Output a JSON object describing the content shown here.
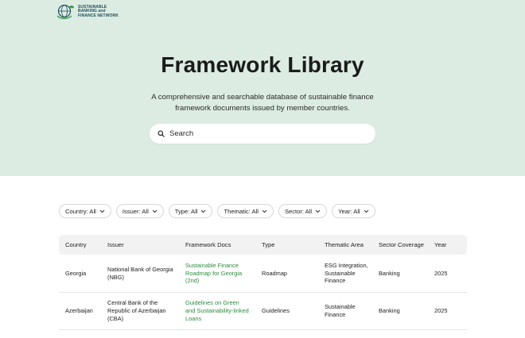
{
  "logo": {
    "line1": "SUSTAINABLE",
    "line2": "BANKING and",
    "line3": "FINANCE NETWORK",
    "icon": "globe-leaf-icon"
  },
  "hero": {
    "title": "Framework Library",
    "subtitle": "A comprehensive and searchable database of sustainable finance framework documents issued by member countries."
  },
  "search": {
    "placeholder": "Search",
    "value": ""
  },
  "filters": [
    {
      "label": "Country: All"
    },
    {
      "label": "Issuer: All"
    },
    {
      "label": "Type: All"
    },
    {
      "label": "Thematic: All"
    },
    {
      "label": "Sector: All"
    },
    {
      "label": "Year: All"
    }
  ],
  "table": {
    "headers": [
      "Country",
      "Issuer",
      "Framework Docs",
      "Type",
      "Thematic Area",
      "Sector Coverage",
      "Year"
    ],
    "rows": [
      {
        "country": "Georgia",
        "issuer": "National Bank of Georgia (NBG)",
        "doc": "Sustainable Finance Roadmap for Georgia (2nd)",
        "type": "Roadmap",
        "thematic": "ESG Integration, Sustainable Finance",
        "sector": "Banking",
        "year": "2025"
      },
      {
        "country": "Azerbaijan",
        "issuer": "Central Bank of the Republic of Azerbaijan (CBA)",
        "doc": "Guidelines on Green and Sustainability-linked Loans",
        "type": "Guidelines",
        "thematic": "Sustainable Finance",
        "sector": "Banking",
        "year": "2025"
      }
    ]
  },
  "colors": {
    "hero_bg": "#dcece2",
    "link": "#2e8a3e",
    "logo": "#1d4f5e"
  }
}
